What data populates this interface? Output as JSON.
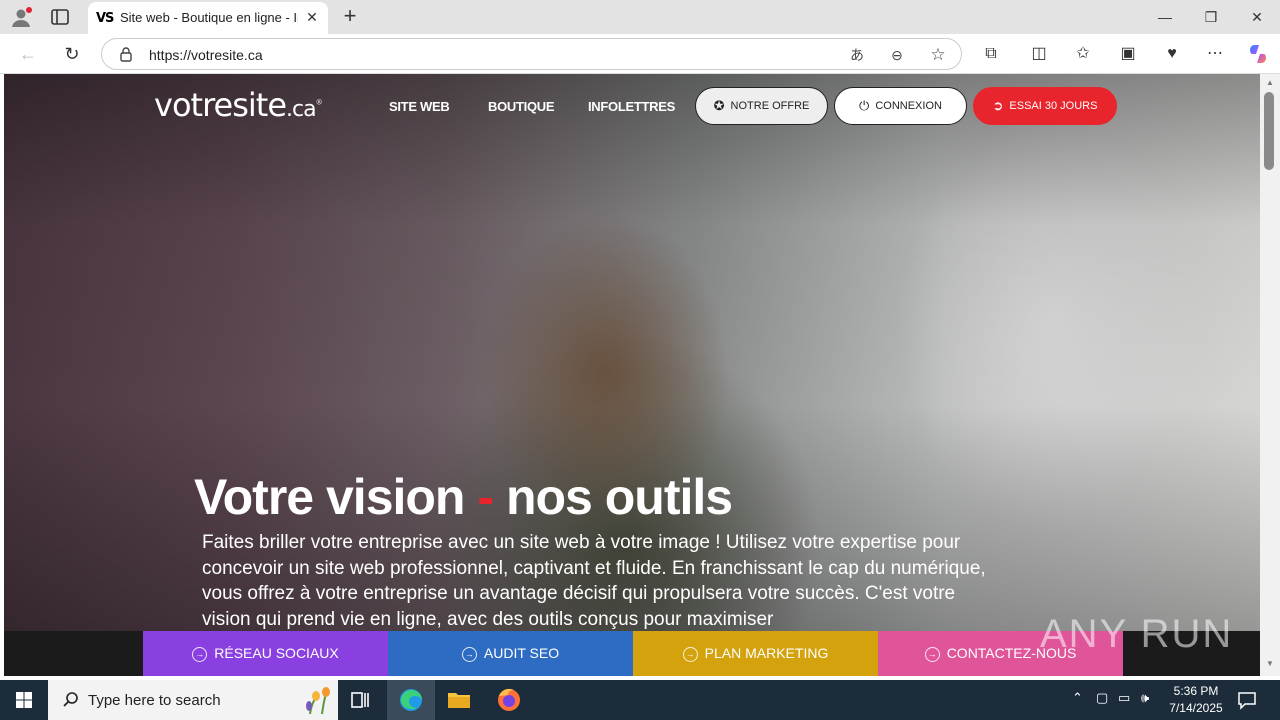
{
  "browser": {
    "tab_title": "Site web - Boutique en ligne - Info",
    "tab_favicon": "VS",
    "tab_close": "✕",
    "new_tab": "+",
    "url": "https://votresite.ca",
    "window": {
      "minimize": "—",
      "restore": "❐",
      "close": "✕"
    }
  },
  "site": {
    "logo_main": "votresite",
    "logo_tld": ".ca",
    "logo_mark": "®",
    "nav": [
      "SITE WEB",
      "BOUTIQUE",
      "INFOLETTRES"
    ],
    "buttons": {
      "offer": "NOTRE OFFRE",
      "login": "CONNEXION",
      "trial": "ESSAI 30 JOURS"
    },
    "hero": {
      "title_a": "Votre vision",
      "title_dash": "-",
      "title_b": "nos outils",
      "paragraph": "Faites briller votre entreprise avec un site web à votre image ! Utilisez votre expertise pour concevoir un site web professionnel, captivant et fluide. En franchissant le cap du numérique, vous offrez à votre entreprise un avantage décisif qui propulsera votre succès. C'est votre vision qui prend vie en ligne, avec des outils conçus pour maximiser"
    },
    "cta": [
      {
        "label": "RÉSEAU SOCIAUX",
        "color": "#8a3fe0"
      },
      {
        "label": "AUDIT SEO",
        "color": "#2e6cc4"
      },
      {
        "label": "PLAN MARKETING",
        "color": "#d4a20c"
      },
      {
        "label": "CONTACTEZ-NOUS",
        "color": "#e0559a"
      }
    ],
    "colors": {
      "accent_red": "#e8242c"
    }
  },
  "watermark": "ANY RUN",
  "taskbar": {
    "search_placeholder": "Type here to search",
    "time": "5:36 PM",
    "date": "7/14/2025"
  }
}
